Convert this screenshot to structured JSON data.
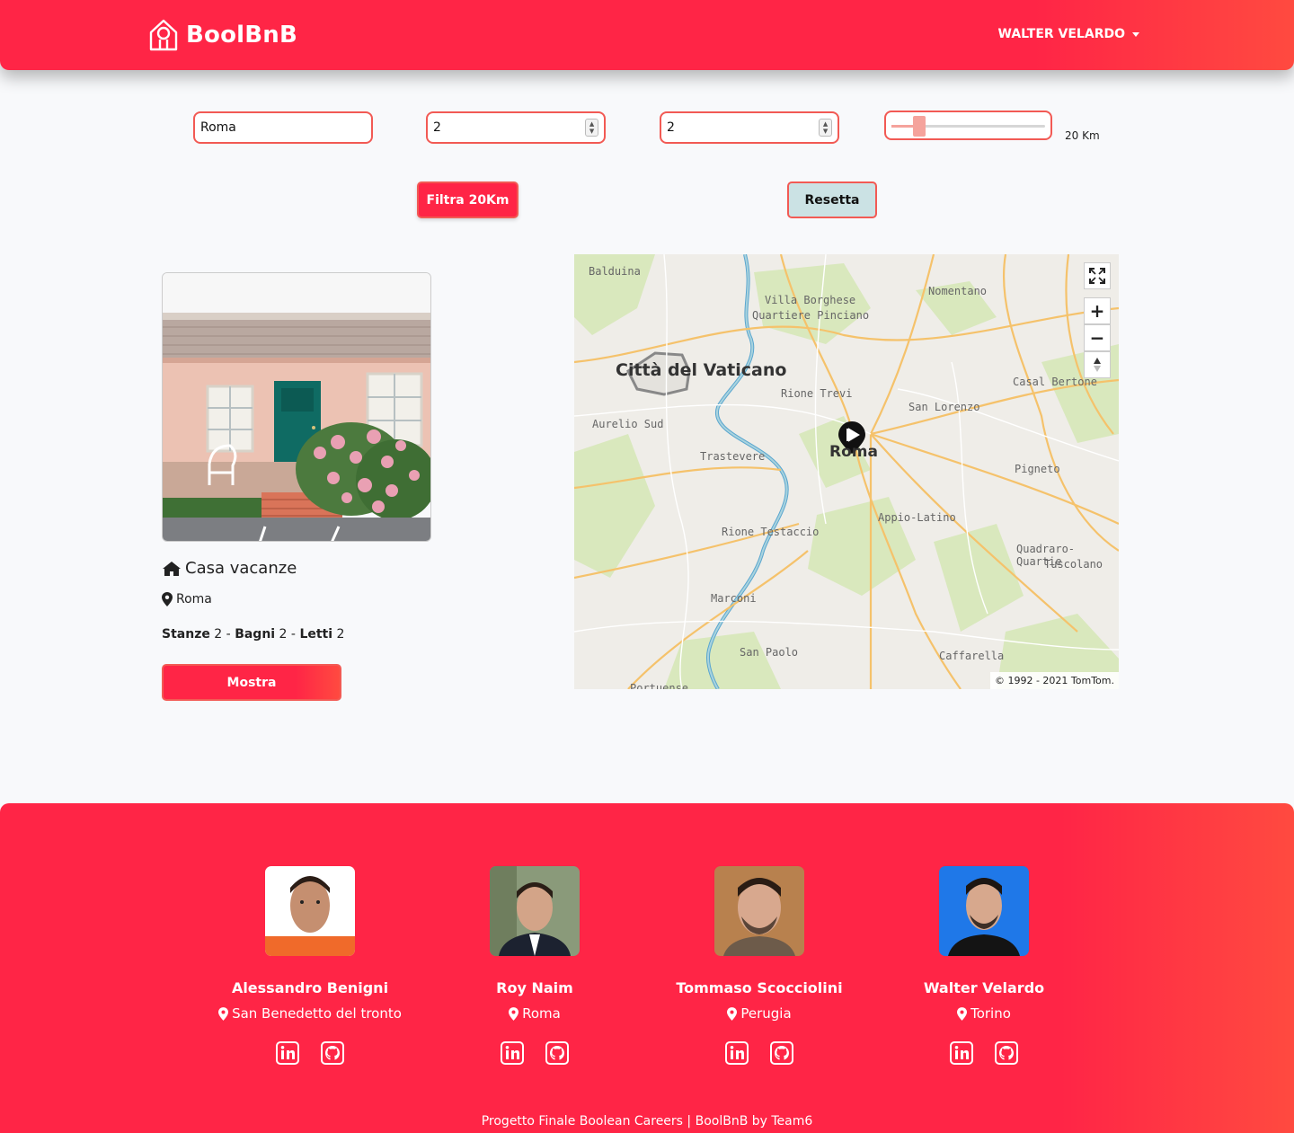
{
  "brand": {
    "name": "BoolBnB",
    "icon": "house-keyhole-icon"
  },
  "user_menu": {
    "label": "WALTER VELARDO"
  },
  "filters": {
    "city": "Roma",
    "rooms": "2",
    "beds": "2",
    "radius_value": 20,
    "radius_max": 100,
    "radius_label": "20 Km",
    "filter_button": "Filtra 20Km",
    "reset_button": "Resetta"
  },
  "listing": {
    "title": "Casa vacanze",
    "city": "Roma",
    "rooms_label": "Stanze",
    "rooms": "2",
    "baths_label": "Bagni",
    "baths": "2",
    "beds_label": "Letti",
    "beds": "2",
    "separator": "-",
    "show_button": "Mostra"
  },
  "map": {
    "labels": {
      "balduina": "Balduina",
      "villa_borghese": "Villa Borghese",
      "quartiere_pinciano": "Quartiere Pinciano",
      "nomentano": "Nomentano",
      "vaticano": "Città del Vaticano",
      "rione_trevi": "Rione Trevi",
      "casal_bertone": "Casal Bertone",
      "san_lorenzo": "San Lorenzo",
      "aurelio_sud": "Aurelio Sud",
      "trastevere": "Trastevere",
      "roma": "Roma",
      "pigneto": "Pigneto",
      "appio_latino": "Appio-Latino",
      "rione_testaccio": "Rione Testaccio",
      "quadraro": "Quadraro-Quartie",
      "tuscolano": "Tuscolano",
      "marconi": "Marconi",
      "san_paolo": "San Paolo",
      "caffarella": "Caffarella",
      "portuense": "Portuense"
    },
    "attribution": "© 1992 - 2021 TomTom.",
    "controls": {
      "fullscreen": "fullscreen-icon",
      "zoom_in": "+",
      "zoom_out": "−",
      "compass": "compass-icon"
    },
    "colors": {
      "water": "#a9d3de",
      "river": "#5aa6cf",
      "road": "#f5c26b",
      "park": "#d8e8b8"
    }
  },
  "footer": {
    "members": [
      {
        "name": "Alessandro Benigni",
        "city": "San Benedetto del tronto"
      },
      {
        "name": "Roy Naim",
        "city": "Roma"
      },
      {
        "name": "Tommaso Scocciolini",
        "city": "Perugia"
      },
      {
        "name": "Walter Velardo",
        "city": "Torino"
      }
    ],
    "credit": "Progetto Finale Boolean Careers | BoolBnB by Team6"
  },
  "colors": {
    "brand": "#ff2546",
    "accent": "#f25a54",
    "reset_bg": "#cbe2e4"
  }
}
